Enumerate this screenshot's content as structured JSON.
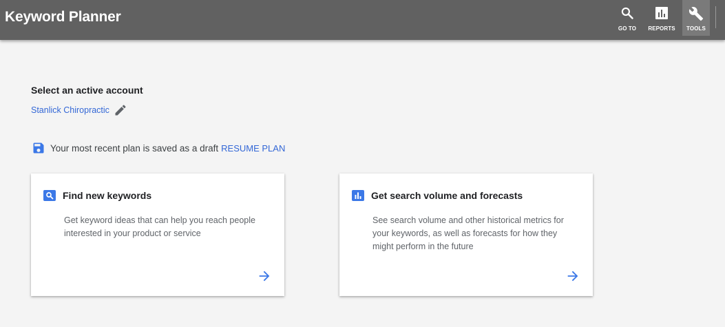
{
  "header": {
    "title": "Keyword Planner",
    "nav": [
      {
        "label": "GO TO",
        "icon": "search-icon"
      },
      {
        "label": "REPORTS",
        "icon": "reports-icon"
      },
      {
        "label": "TOOLS",
        "icon": "wrench-icon",
        "active": true
      }
    ]
  },
  "account": {
    "heading": "Select an active account",
    "name": "Stanlick Chiropractic",
    "edit_icon": "pencil-icon"
  },
  "draft": {
    "icon": "floppy-disk-icon",
    "message": "Your most recent plan is saved as a draft",
    "resume_label": "RESUME PLAN"
  },
  "cards": [
    {
      "icon": "magnifier-badge-icon",
      "title": "Find new keywords",
      "description": "Get keyword ideas that can help you reach people interested in your product or service",
      "action_icon": "arrow-right-icon"
    },
    {
      "icon": "bar-chart-badge-icon",
      "title": "Get search volume and forecasts",
      "description": "See search volume and other historical metrics for your keywords, as well as forecasts for how they might perform in the future",
      "action_icon": "arrow-right-icon"
    }
  ],
  "colors": {
    "header_bg": "#616161",
    "active_tab_bg": "#7a7a7a",
    "page_bg": "#f4f4f4",
    "link": "#3367d6",
    "badge": "#3b78e7"
  }
}
